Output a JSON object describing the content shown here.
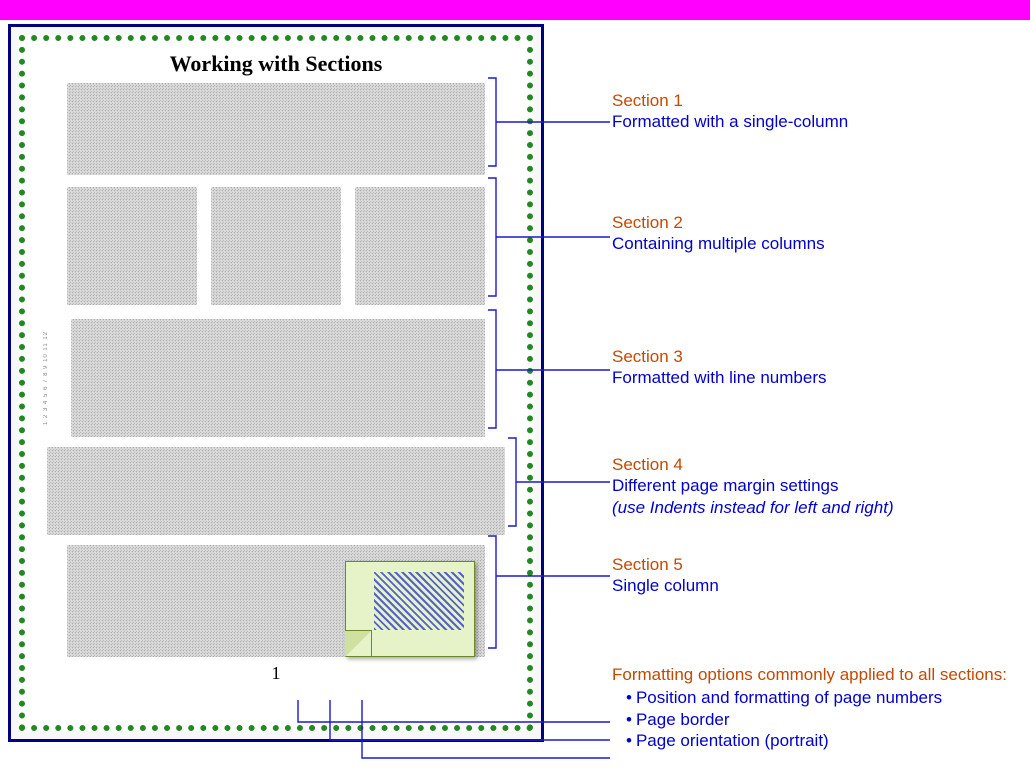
{
  "page": {
    "title": "Working with Sections",
    "page_number": "1"
  },
  "callouts": [
    {
      "header": "Section 1",
      "text": "Formatted with a single-column",
      "note": ""
    },
    {
      "header": "Section 2",
      "text": "Containing multiple columns",
      "note": ""
    },
    {
      "header": "Section 3",
      "text": "Formatted with line numbers",
      "note": ""
    },
    {
      "header": "Section 4",
      "text": "Different page margin settings",
      "note": "(use Indents instead for left and right)"
    },
    {
      "header": "Section 5",
      "text": "Single column",
      "note": ""
    }
  ],
  "footer": {
    "header": "Formatting options commonly applied to all sections:",
    "bullets": [
      "Position and formatting of page numbers",
      "Page border",
      "Page orientation (portrait)"
    ]
  }
}
